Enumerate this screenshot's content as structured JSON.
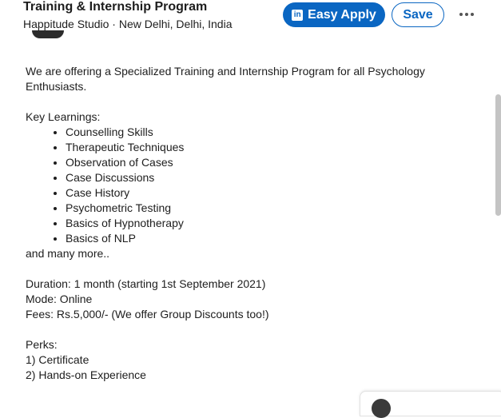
{
  "header": {
    "title": "Training & Internship Program",
    "subtitle": "Happitude Studio · New Delhi, Delhi, India",
    "easy_apply_label": "Easy Apply",
    "save_label": "Save",
    "more_icon": "ellipsis-icon",
    "brand_color": "#0a66c2"
  },
  "description": {
    "intro": "We are offering a Specialized Training and Internship Program for all Psychology Enthusiasts.",
    "learnings_heading": "Key Learnings:",
    "learnings": [
      "Counselling Skills",
      "Therapeutic Techniques",
      "Observation of Cases",
      "Case Discussions",
      "Case History",
      "Psychometric Testing",
      "Basics of Hypnotherapy",
      "Basics of NLP"
    ],
    "more": "and many more..",
    "duration": "Duration: 1 month (starting 1st September 2021)",
    "mode": "Mode: Online",
    "fees": "Fees: Rs.5,000/- (We offer Group Discounts too!)",
    "perks_heading": "Perks:",
    "perks": [
      "1) Certificate",
      "2) Hands-on Experience"
    ]
  }
}
